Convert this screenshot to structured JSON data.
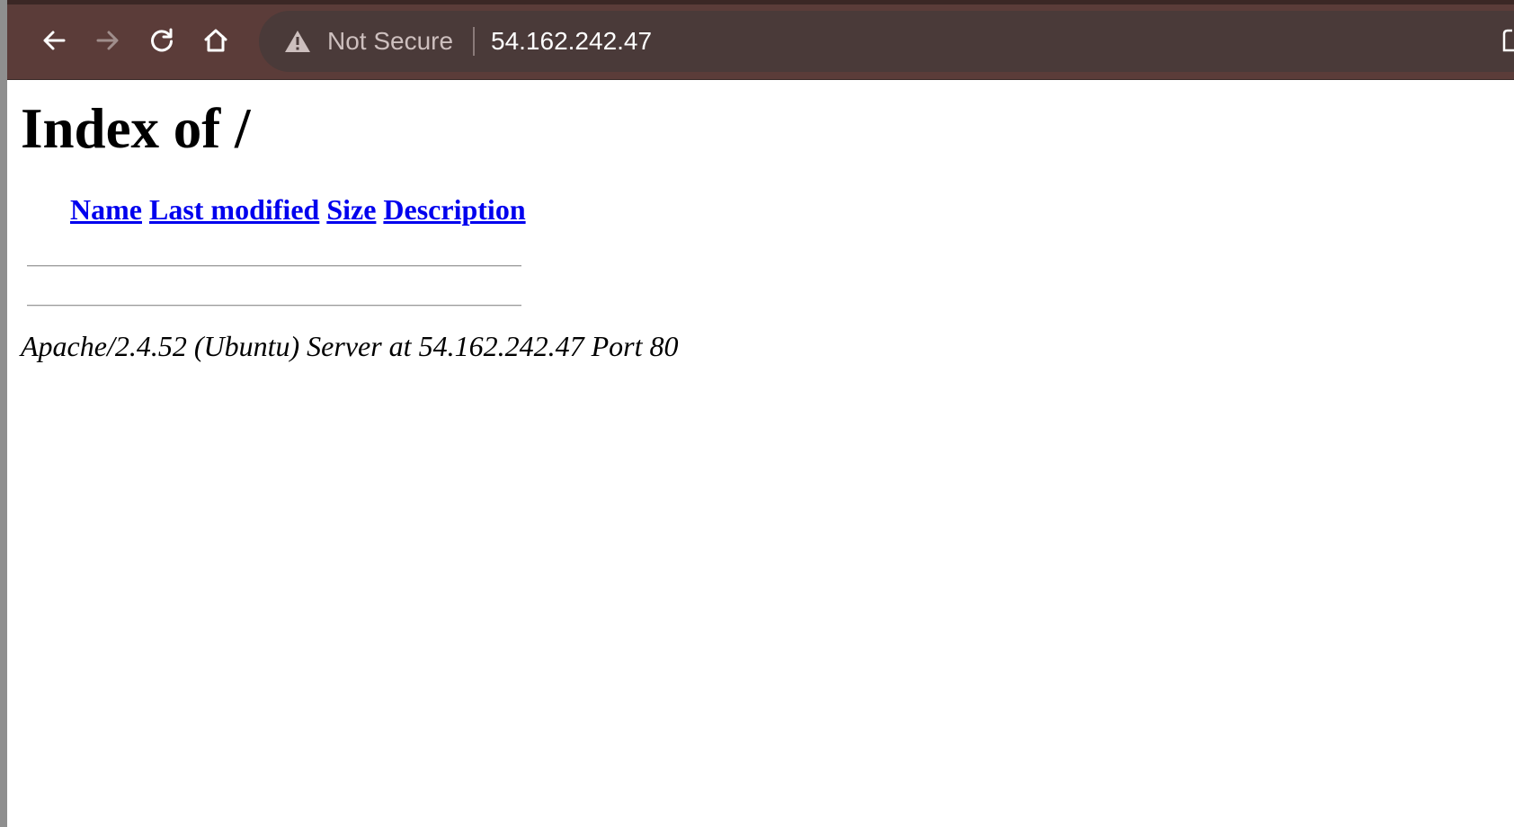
{
  "browser": {
    "security_label": "Not Secure",
    "url": "54.162.242.47",
    "icons": {
      "back": "back-arrow-icon",
      "forward": "forward-arrow-icon",
      "reload": "reload-icon",
      "home": "home-icon",
      "warning": "warning-triangle-icon",
      "share": "share-icon"
    },
    "colors": {
      "toolbar": "#5b3c39",
      "omnibox": "#4a3a39"
    }
  },
  "page": {
    "title": "Index of /",
    "columns": [
      "Name",
      "Last modified",
      "Size",
      "Description"
    ],
    "address": "Apache/2.4.52 (Ubuntu) Server at 54.162.242.47 Port 80",
    "link_color": "#0000ee"
  }
}
